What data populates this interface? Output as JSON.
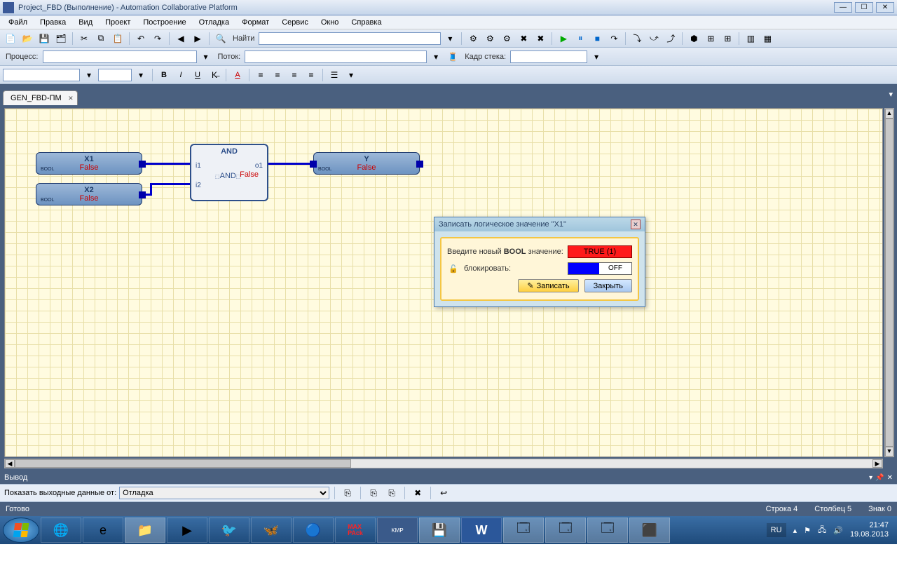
{
  "window": {
    "title": "Project_FBD (Выполнение) - Automation Collaborative Platform"
  },
  "menu": {
    "file": "Файл",
    "edit": "Правка",
    "view": "Вид",
    "project": "Проект",
    "build": "Построение",
    "debug": "Отладка",
    "format": "Формат",
    "service": "Сервис",
    "window": "Окно",
    "help": "Справка"
  },
  "toolbar2": {
    "find_label": "Найти",
    "process_label": "Процесс:",
    "thread_label": "Поток:",
    "stackframe_label": "Кадр стека:"
  },
  "tab": {
    "name": "GEN_FBD-ПМ"
  },
  "blocks": {
    "x1": {
      "name": "X1",
      "type": "BOOL",
      "value": "False"
    },
    "x2": {
      "name": "X2",
      "type": "BOOL",
      "value": "False"
    },
    "and": {
      "title": "AND",
      "i1": "i1",
      "i2": "i2",
      "o1": "o1",
      "value": "False",
      "sym": "AND"
    },
    "y": {
      "name": "Y",
      "type": "BOOL",
      "value": "False"
    }
  },
  "dialog": {
    "title": "Записать логическое значение \"X1\"",
    "prompt_prefix": "Введите новый ",
    "prompt_bold": "BOOL",
    "prompt_suffix": " значение:",
    "true_value": "TRUE (1)",
    "lock_label": "блокировать:",
    "off": "OFF",
    "write": "Записать",
    "close": "Закрыть"
  },
  "output": {
    "panel_title": "Вывод",
    "show_label": "Показать выходные данные от:",
    "source": "Отладка"
  },
  "status": {
    "ready": "Готово",
    "line": "Строка 4",
    "col": "Столбец 5",
    "char": "Знак 0"
  },
  "tray": {
    "lang": "RU",
    "time": "21:47",
    "date": "19.08.2013"
  }
}
